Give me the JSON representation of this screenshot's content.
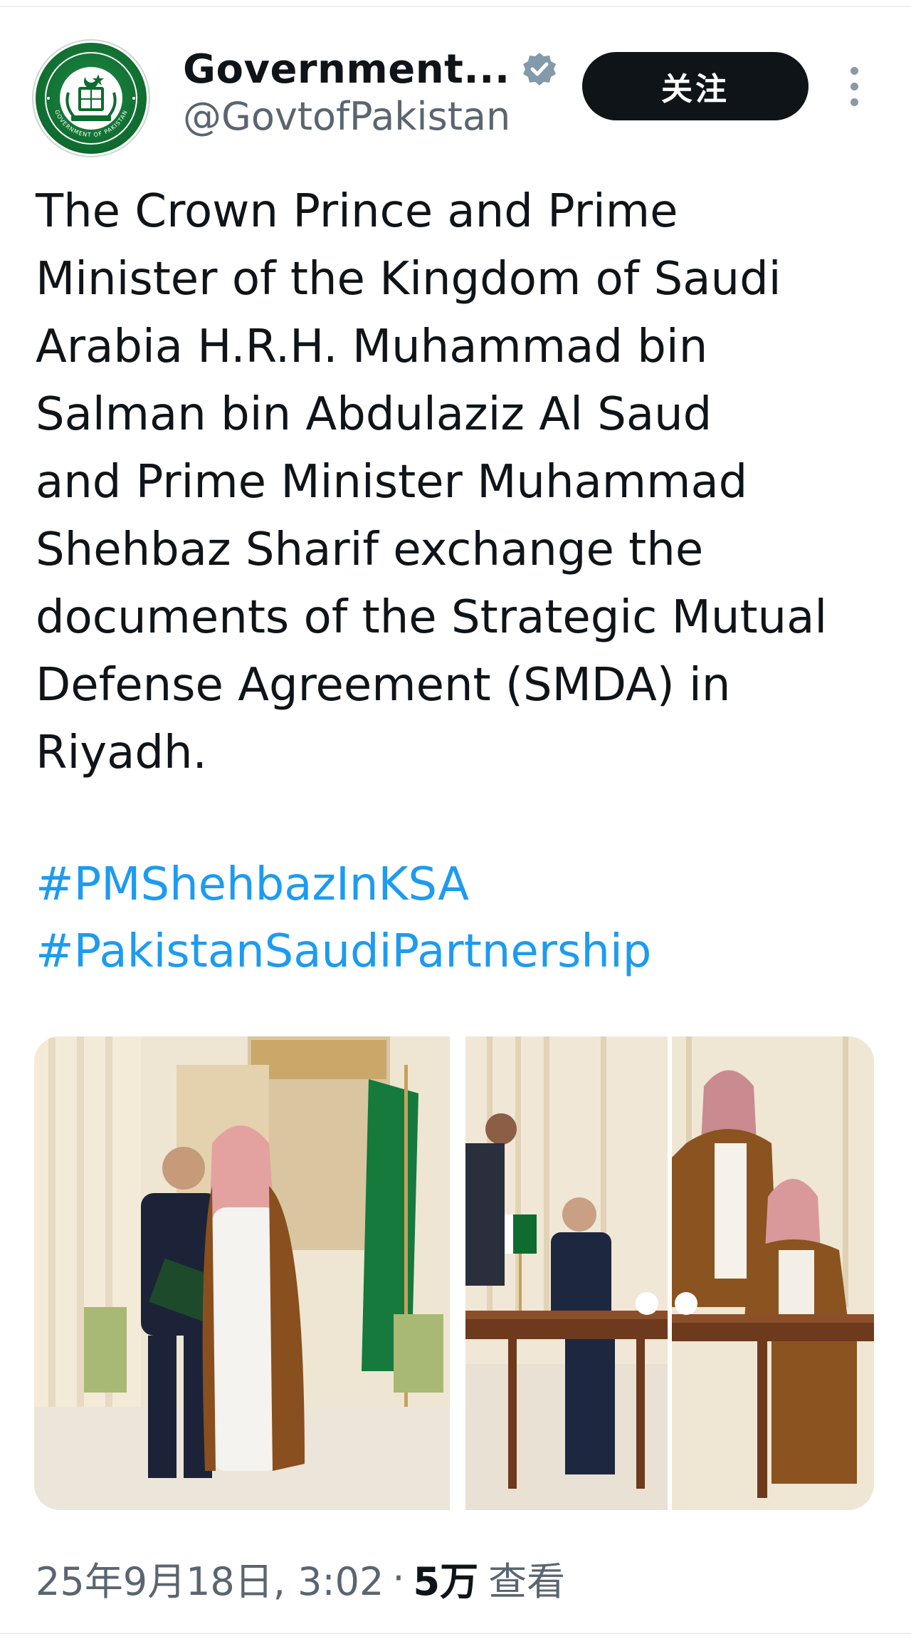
{
  "account": {
    "display_name": "Government...",
    "handle": "@GovtofPakistan",
    "verified": true,
    "avatar_icon": "government-of-pakistan-emblem",
    "avatar_text": "GOVERNMENT OF PAKISTAN"
  },
  "actions": {
    "follow_label": "关注",
    "more_icon": "more-vertical-icon"
  },
  "tweet": {
    "text": "The Crown Prince and Prime\nMinister of the Kingdom of Saudi\nArabia H.R.H. Muhammad bin\nSalman bin Abdulaziz Al Saud\nand Prime Minister Muhammad\nShehbaz Sharif exchange the\ndocuments of the Strategic Mutual\nDefense Agreement (SMDA) in\nRiyadh.",
    "hashtags": [
      "#PMShehbazInKSA",
      "#PakistanSaudiPartnership"
    ]
  },
  "media": {
    "count": 3
  },
  "meta": {
    "timestamp": "25年9月18日, 3:02",
    "separator": "·",
    "views": "5万",
    "views_label": "查看"
  },
  "colors": {
    "text": "#0f1419",
    "secondary": "#5a6570",
    "link": "#1d9bf0",
    "follow_bg": "#0f1419",
    "verified": "#829aab"
  }
}
